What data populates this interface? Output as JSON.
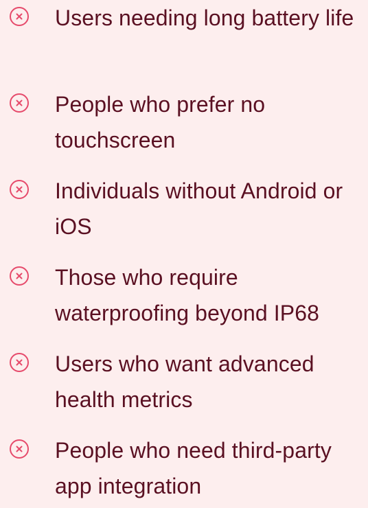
{
  "theme": {
    "background": "#fdeeee",
    "text_color": "#5a1022",
    "icon_color": "#e64a6b"
  },
  "cons_list": {
    "items": [
      {
        "icon": "close-circle-icon",
        "text": "Users needing long battery life"
      },
      {
        "icon": "close-circle-icon",
        "text": "People who prefer no touchscreen"
      },
      {
        "icon": "close-circle-icon",
        "text": "Individuals without Android or iOS"
      },
      {
        "icon": "close-circle-icon",
        "text": "Those who require waterproofing beyond IP68"
      },
      {
        "icon": "close-circle-icon",
        "text": "Users who want advanced health metrics"
      },
      {
        "icon": "close-circle-icon",
        "text": "People who need third-party app integration"
      }
    ]
  }
}
